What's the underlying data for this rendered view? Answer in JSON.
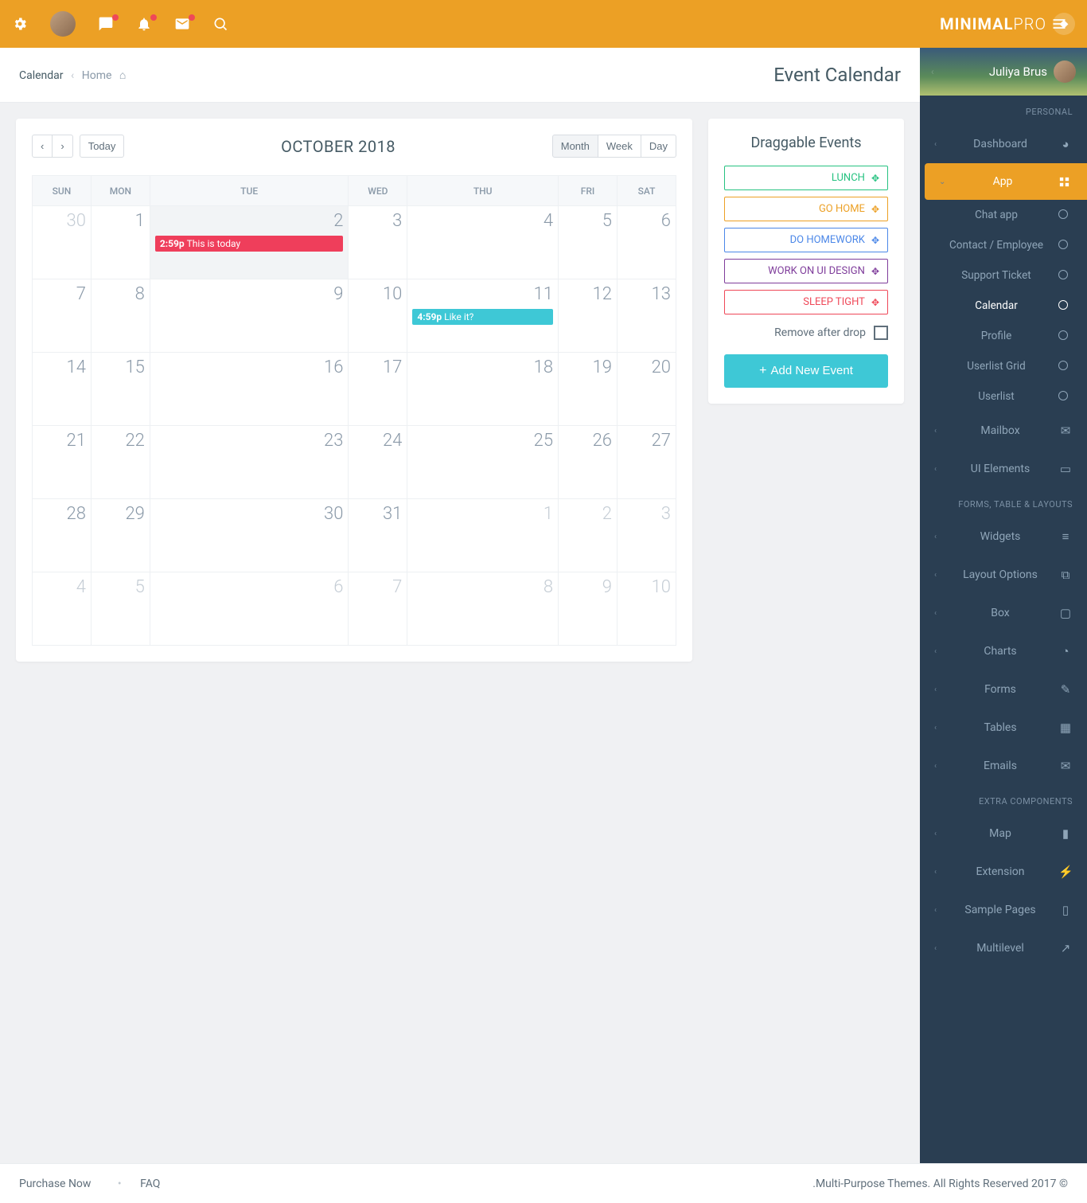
{
  "brand": "MINIMALPRO",
  "user": {
    "name": "Juliya Brus"
  },
  "nav_sections": [
    {
      "header": "PERSONAL"
    },
    {
      "header": "FORMS, TABLE & LAYOUTS"
    },
    {
      "header": "EXTRA COMPONENTS"
    }
  ],
  "nav": {
    "dashboard": "Dashboard",
    "app": "App",
    "chat": "Chat app",
    "contact": "Contact / Employee",
    "support": "Support Ticket",
    "calendar": "Calendar",
    "profile": "Profile",
    "usergrid": "Userlist Grid",
    "userlist": "Userlist",
    "mailbox": "Mailbox",
    "uiel": "UI Elements",
    "widgets": "Widgets",
    "layout": "Layout Options",
    "box": "Box",
    "charts": "Charts",
    "forms": "Forms",
    "tables": "Tables",
    "emails": "Emails",
    "map": "Map",
    "extension": "Extension",
    "sample": "Sample Pages",
    "multi": "Multilevel"
  },
  "breadcrumb": {
    "here": "Calendar",
    "home": "Home"
  },
  "page_title": "Event Calendar",
  "toolbar": {
    "today": "Today",
    "month": "Month",
    "week": "Week",
    "day": "Day",
    "title": "OCTOBER 2018"
  },
  "dow": [
    "SUN",
    "MON",
    "TUE",
    "WED",
    "THU",
    "FRI",
    "SAT"
  ],
  "weeks": [
    [
      {
        "n": "30",
        "o": true
      },
      {
        "n": "1"
      },
      {
        "n": "2",
        "today": true,
        "ev": {
          "cls": "ev-red",
          "time": "2:59p",
          "txt": "This is today"
        }
      },
      {
        "n": "3"
      },
      {
        "n": "4"
      },
      {
        "n": "5"
      },
      {
        "n": "6"
      }
    ],
    [
      {
        "n": "7"
      },
      {
        "n": "8"
      },
      {
        "n": "9"
      },
      {
        "n": "10"
      },
      {
        "n": "11",
        "ev": {
          "cls": "ev-teal",
          "time": "4:59p",
          "txt": "Like it?"
        }
      },
      {
        "n": "12"
      },
      {
        "n": "13"
      }
    ],
    [
      {
        "n": "14"
      },
      {
        "n": "15"
      },
      {
        "n": "16"
      },
      {
        "n": "17"
      },
      {
        "n": "18"
      },
      {
        "n": "19"
      },
      {
        "n": "20"
      }
    ],
    [
      {
        "n": "21"
      },
      {
        "n": "22"
      },
      {
        "n": "23"
      },
      {
        "n": "24"
      },
      {
        "n": "25"
      },
      {
        "n": "26"
      },
      {
        "n": "27"
      }
    ],
    [
      {
        "n": "28"
      },
      {
        "n": "29"
      },
      {
        "n": "30"
      },
      {
        "n": "31"
      },
      {
        "n": "1",
        "o": true
      },
      {
        "n": "2",
        "o": true
      },
      {
        "n": "3",
        "o": true
      }
    ],
    [
      {
        "n": "4",
        "o": true
      },
      {
        "n": "5",
        "o": true
      },
      {
        "n": "6",
        "o": true
      },
      {
        "n": "7",
        "o": true
      },
      {
        "n": "8",
        "o": true
      },
      {
        "n": "9",
        "o": true
      },
      {
        "n": "10",
        "o": true
      }
    ]
  ],
  "drag": {
    "title": "Draggable Events",
    "items": [
      {
        "label": "LUNCH",
        "cls": "c-green"
      },
      {
        "label": "GO HOME",
        "cls": "c-orange"
      },
      {
        "label": "DO HOMEWORK",
        "cls": "c-blue"
      },
      {
        "label": "WORK ON UI DESIGN",
        "cls": "c-purple"
      },
      {
        "label": "SLEEP TIGHT",
        "cls": "c-red"
      }
    ],
    "remove": "Remove after drop",
    "add": "Add New Event"
  },
  "footer": {
    "purchase": "Purchase Now",
    "faq": "FAQ",
    "copy": ".Multi-Purpose Themes. All Rights Reserved 2017 ©"
  }
}
